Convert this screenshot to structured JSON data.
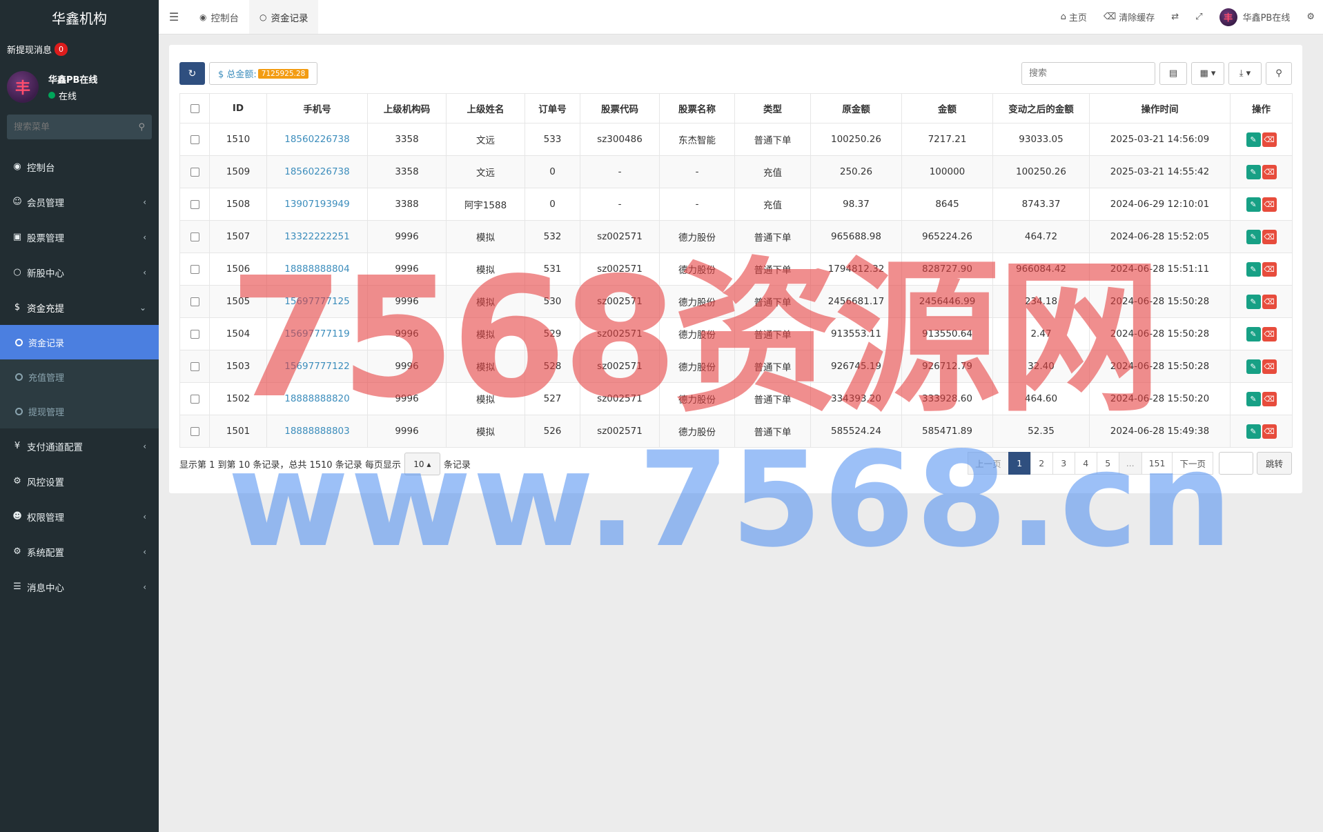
{
  "brand": "华鑫机构",
  "sidebar": {
    "new_withdraw_label": "新提现消息",
    "new_withdraw_count": "0",
    "avatar_char": "丰",
    "user_name": "华鑫PB在线",
    "user_status": "在线",
    "search_placeholder": "搜索菜单",
    "menu": [
      {
        "label": "控制台",
        "icon": "dashboard-icon"
      },
      {
        "label": "会员管理",
        "icon": "user-circle-icon"
      },
      {
        "label": "股票管理",
        "icon": "bank-icon"
      },
      {
        "label": "新股中心",
        "icon": "circle-icon"
      },
      {
        "label": "资金充提",
        "icon": "dollar-icon"
      }
    ],
    "submenu": [
      {
        "label": "资金记录"
      },
      {
        "label": "充值管理"
      },
      {
        "label": "提现管理"
      }
    ],
    "menu2": [
      {
        "label": "支付通道配置",
        "icon": "yen-icon"
      },
      {
        "label": "风控设置",
        "icon": "gear-icon"
      },
      {
        "label": "权限管理",
        "icon": "users-icon"
      },
      {
        "label": "系统配置",
        "icon": "cog-icon"
      },
      {
        "label": "消息中心",
        "icon": "list-icon"
      }
    ]
  },
  "topbar": {
    "tabs": [
      {
        "label": "控制台"
      },
      {
        "label": "资金记录"
      }
    ],
    "home": "主页",
    "clear_cache": "清除缓存",
    "user": "华鑫PB在线"
  },
  "toolbar": {
    "total_label": "$ 总金额:",
    "total_value": "7125925.28",
    "search_placeholder": "搜索"
  },
  "table": {
    "headers": [
      "ID",
      "手机号",
      "上级机构码",
      "上级姓名",
      "订单号",
      "股票代码",
      "股票名称",
      "类型",
      "原金额",
      "金额",
      "变动之后的金额",
      "操作时间",
      "操作"
    ],
    "rows": [
      [
        "1510",
        "18560226738",
        "3358",
        "文远",
        "533",
        "sz300486",
        "东杰智能",
        "普通下单",
        "100250.26",
        "7217.21",
        "93033.05",
        "2025-03-21 14:56:09"
      ],
      [
        "1509",
        "18560226738",
        "3358",
        "文远",
        "0",
        "-",
        "-",
        "充值",
        "250.26",
        "100000",
        "100250.26",
        "2025-03-21 14:55:42"
      ],
      [
        "1508",
        "13907193949",
        "3388",
        "阿宇1588",
        "0",
        "-",
        "-",
        "充值",
        "98.37",
        "8645",
        "8743.37",
        "2024-06-29 12:10:01"
      ],
      [
        "1507",
        "13322222251",
        "9996",
        "模拟",
        "532",
        "sz002571",
        "德力股份",
        "普通下单",
        "965688.98",
        "965224.26",
        "464.72",
        "2024-06-28 15:52:05"
      ],
      [
        "1506",
        "18888888804",
        "9996",
        "模拟",
        "531",
        "sz002571",
        "德力股份",
        "普通下单",
        "1794812.32",
        "828727.90",
        "966084.42",
        "2024-06-28 15:51:11"
      ],
      [
        "1505",
        "15697777125",
        "9996",
        "模拟",
        "530",
        "sz002571",
        "德力股份",
        "普通下单",
        "2456681.17",
        "2456446.99",
        "234.18",
        "2024-06-28 15:50:28"
      ],
      [
        "1504",
        "15697777119",
        "9996",
        "模拟",
        "529",
        "sz002571",
        "德力股份",
        "普通下单",
        "913553.11",
        "913550.64",
        "2.47",
        "2024-06-28 15:50:28"
      ],
      [
        "1503",
        "15697777122",
        "9996",
        "模拟",
        "528",
        "sz002571",
        "德力股份",
        "普通下单",
        "926745.19",
        "926712.79",
        "32.40",
        "2024-06-28 15:50:28"
      ],
      [
        "1502",
        "18888888820",
        "9996",
        "模拟",
        "527",
        "sz002571",
        "德力股份",
        "普通下单",
        "334393.20",
        "333928.60",
        "464.60",
        "2024-06-28 15:50:20"
      ],
      [
        "1501",
        "18888888803",
        "9996",
        "模拟",
        "526",
        "sz002571",
        "德力股份",
        "普通下单",
        "585524.24",
        "585471.89",
        "52.35",
        "2024-06-28 15:49:38"
      ]
    ]
  },
  "pager": {
    "info_prefix": "显示第 1 到第 10 条记录，总共 1510 条记录 每页显示",
    "per_page": "10",
    "info_suffix": "条记录",
    "prev": "上一页",
    "pages": [
      "1",
      "2",
      "3",
      "4",
      "5",
      "...",
      "151"
    ],
    "next": "下一页",
    "jump": "跳转"
  },
  "watermark": {
    "line1": "7568资源网",
    "line2": "www.7568.cn"
  }
}
